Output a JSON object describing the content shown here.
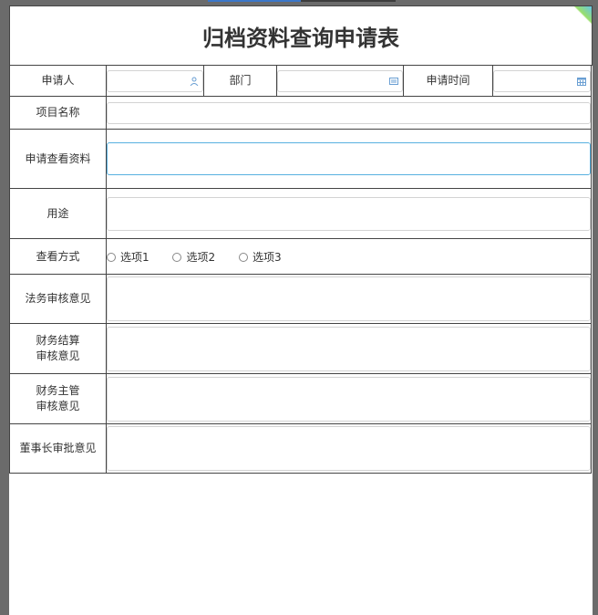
{
  "form": {
    "title": "归档资料查询申请表",
    "fields": {
      "applicant": {
        "label": "申请人",
        "value": "",
        "icon": "user-icon"
      },
      "department": {
        "label": "部门",
        "value": "",
        "icon": "list-icon"
      },
      "apply_time": {
        "label": "申请时间",
        "value": "",
        "icon": "calendar-icon"
      },
      "project_name": {
        "label": "项目名称",
        "value": ""
      },
      "materials": {
        "label": "申请查看资料",
        "value": ""
      },
      "purpose": {
        "label": "用途",
        "value": ""
      },
      "view_method": {
        "label": "查看方式",
        "options": [
          "选项1",
          "选项2",
          "选项3"
        ],
        "selected": null
      },
      "legal_opinion": {
        "label": "法务审核意见",
        "value": ""
      },
      "finance_settlement": {
        "label_line1": "财务结算",
        "label_line2": "审核意见",
        "value": ""
      },
      "finance_manager": {
        "label_line1": "财务主管",
        "label_line2": "审核意见",
        "value": ""
      },
      "chairman_opinion": {
        "label": "董事长审批意见",
        "value": ""
      }
    }
  },
  "colors": {
    "window_bg": "#6b6b6b",
    "accent": "#3b77c8",
    "focus_border": "#58b1e0",
    "icon": "#6a9fd3"
  }
}
